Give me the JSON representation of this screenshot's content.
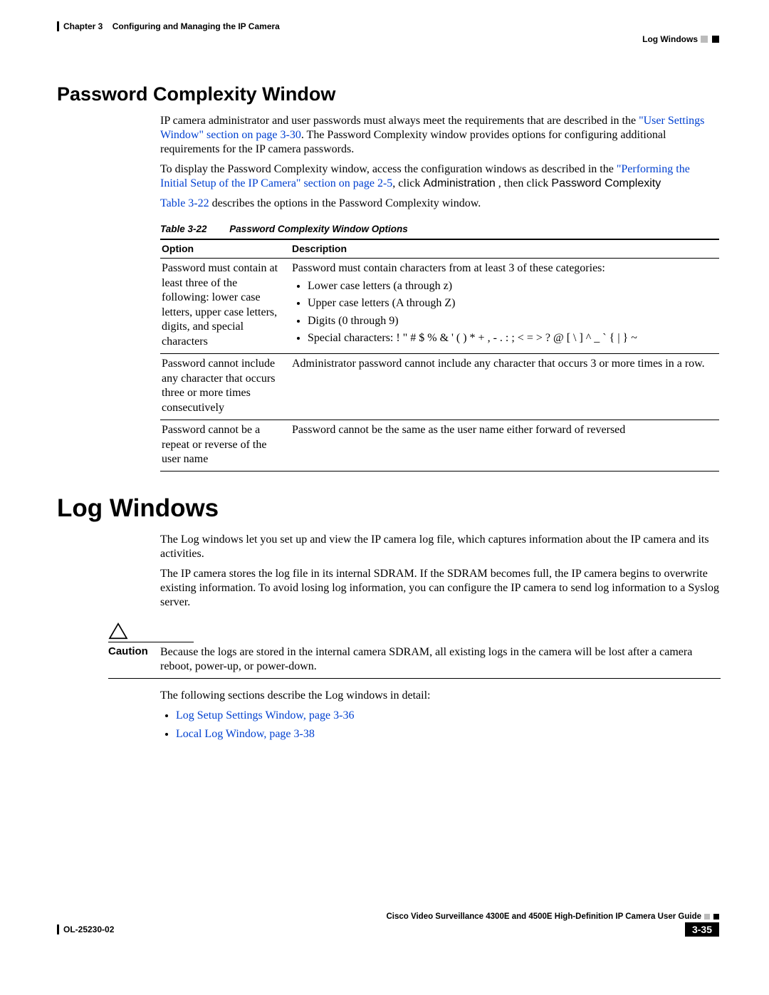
{
  "header": {
    "chapter_label": "Chapter 3",
    "chapter_title": "Configuring and Managing the IP Camera",
    "section_right": "Log Windows"
  },
  "section1": {
    "heading": "Password Complexity Window",
    "para1_prefix": "IP camera administrator and user passwords must always meet the requirements that are described in the ",
    "para1_link": "\"User Settings Window\" section on page 3-30",
    "para1_suffix": ". The Password Complexity window provides options for configuring additional requirements for the IP camera passwords.",
    "para2_prefix": "To display the Password Complexity window, access the configuration windows as described in the ",
    "para2_link": "\"Performing the Initial Setup of the IP Camera\" section on page 2-5",
    "para2_mid": ", click ",
    "para2_admin": "Administration",
    "para2_mid2": " , then click ",
    "para2_pc": "Password Complexity",
    "para3_link": "Table 3-22",
    "para3_suffix": " describes the options in the Password Complexity window.",
    "table_caption_label": "Table 3-22",
    "table_caption_title": "Password Complexity Window Options",
    "table": {
      "th_option": "Option",
      "th_desc": "Description",
      "row1": {
        "opt": "Password must contain at least three of the following: lower case letters, upper case letters, digits, and special characters",
        "desc_intro": "Password must contain characters from at least 3 of these categories:",
        "items": [
          "Lower case letters (a through z)",
          "Upper case letters (A through Z)",
          "Digits (0 through 9)",
          "Special characters: ! \" # $ % & ' ( ) * + , - . : ; < = > ? @ [ \\ ] ^ _ ` { | } ~"
        ]
      },
      "row2": {
        "opt": "Password cannot include any character that occurs three or more times consecutively",
        "desc": "Administrator password cannot include any character that occurs 3 or more times in a row."
      },
      "row3": {
        "opt": "Password cannot be a repeat or reverse of the user name",
        "desc": "Password cannot be the same as the user name either forward of reversed"
      }
    }
  },
  "section2": {
    "heading": "Log Windows",
    "para1": "The Log windows let you set up and view the IP camera log file, which captures information about the IP camera and its activities.",
    "para2": "The IP camera stores the log file in its internal SDRAM. If the SDRAM becomes full, the IP camera begins to overwrite existing information. To avoid losing log information, you can configure the IP camera to send log information to a Syslog server.",
    "caution_label": "Caution",
    "caution_text": "Because the logs are stored in the internal camera SDRAM, all existing logs in the camera will be lost after a camera reboot, power-up, or power-down.",
    "para3": "The following sections describe the Log windows in detail:",
    "links": [
      "Log Setup Settings Window, page 3-36",
      "Local Log Window, page 3-38"
    ]
  },
  "footer": {
    "book_title": "Cisco Video Surveillance 4300E and 4500E High-Definition IP Camera User Guide",
    "doc_id": "OL-25230-02",
    "page_no": "3-35"
  }
}
